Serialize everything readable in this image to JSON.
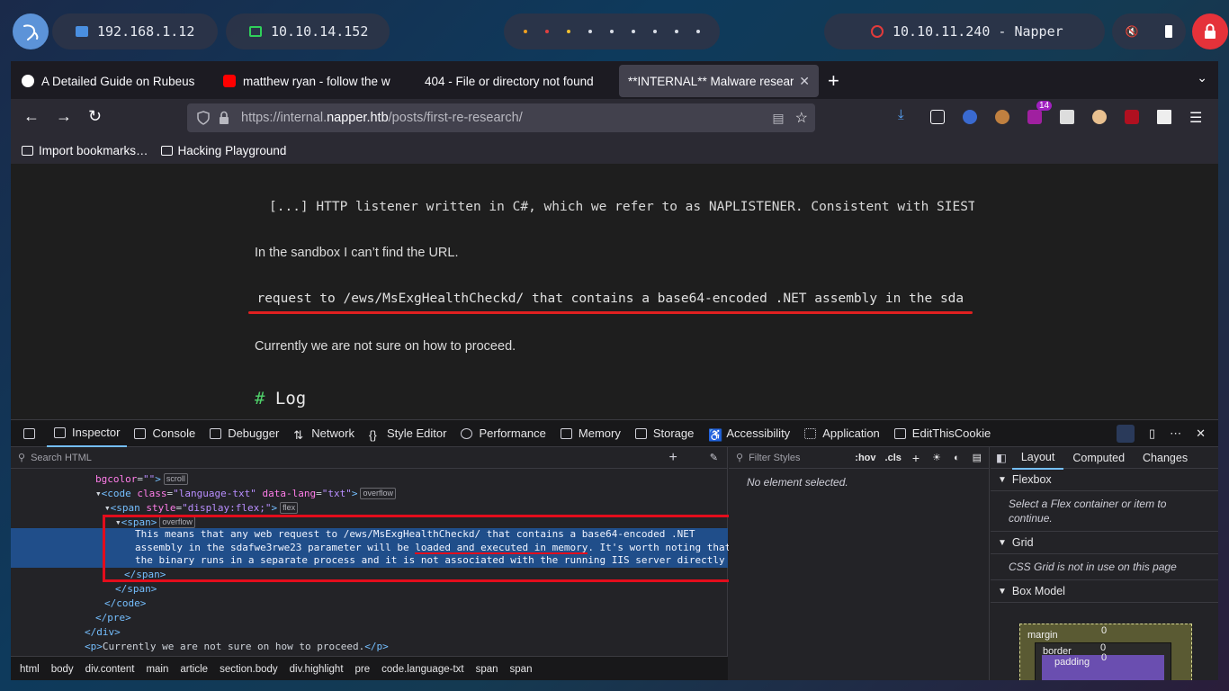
{
  "desktop": {
    "ip_local": "192.168.1.12",
    "ip_vpn": "10.10.14.152",
    "target": "10.10.11.240 - Napper"
  },
  "tabs": [
    {
      "label": "A Detailed Guide on Rubeus",
      "favicon": "wordpress-icon"
    },
    {
      "label": "matthew ryan - follow the w",
      "favicon": "youtube-icon"
    },
    {
      "label": "404 - File or directory not found",
      "favicon": "none"
    },
    {
      "label": "**INTERNAL** Malware research",
      "favicon": "none",
      "active": true
    }
  ],
  "url": {
    "prefix": "https://internal.",
    "host": "napper.htb",
    "path": "/posts/first-re-research/"
  },
  "bookmarks": {
    "import": "Import bookmarks…",
    "folder": "Hacking Playground"
  },
  "toolbar": {
    "notification_count": "14"
  },
  "page": {
    "quote": "[...] HTTP listener written in C#, which we refer to as NAPLISTENER. Consistent with SIEST",
    "para1": "In the sandbox I can’t find the URL.",
    "codeline": "b request to /ews/MsExgHealthCheckd/ that contains a base64-encoded .NET assembly in the sda",
    "para2": "Currently we are not sure on how to proceed.",
    "heading_hash": "#",
    "heading_text": "Log"
  },
  "devtools": {
    "tabs": [
      "Inspector",
      "Console",
      "Debugger",
      "Network",
      "Style Editor",
      "Performance",
      "Memory",
      "Storage",
      "Accessibility",
      "Application",
      "EditThisCookie"
    ],
    "search_placeholder": "Search HTML",
    "markup": {
      "bgcolor_attr": "bgcolor",
      "bgcolor_val": "\"\"",
      "scroll_badge": "scroll",
      "code_tag": "code",
      "code_class_attr": "class",
      "code_class_val": "\"language-txt\"",
      "code_lang_attr": "data-lang",
      "code_lang_val": "\"txt\"",
      "overflow_badge": "overflow",
      "span_style_attr": "style",
      "span_style_val": "\"display:flex;\"",
      "flex_badge": "flex",
      "selected_text_1": "This means that any web request to /ews/MsExgHealthCheckd/ that contains a base64-encoded .NET",
      "selected_text_2": "assembly in the sdafwe3rwe23 parameter will be loaded and executed in memory. It's worth noting that",
      "selected_text_3": "the binary runs in a separate process and it is not associated with the running IIS server directly",
      "para_text": "Currently we are not sure on how to proceed."
    },
    "breadcrumbs": [
      "html",
      "body",
      "div.content",
      "main",
      "article",
      "section.body",
      "div.highlight",
      "pre",
      "code.language-txt",
      "span",
      "span"
    ],
    "rules": {
      "filter_placeholder": "Filter Styles",
      "hov": ":hov",
      "cls": ".cls",
      "empty": "No element selected."
    },
    "layout": {
      "tabs": [
        "Layout",
        "Computed",
        "Changes"
      ],
      "flexbox_title": "Flexbox",
      "flexbox_body": "Select a Flex container or item to continue.",
      "grid_title": "Grid",
      "grid_body": "CSS Grid is not in use on this page",
      "boxmodel_title": "Box Model",
      "margin": "margin",
      "border": "border",
      "padding": "padding",
      "margin_val": "0",
      "border_val": "0",
      "padding_val": "0"
    }
  }
}
